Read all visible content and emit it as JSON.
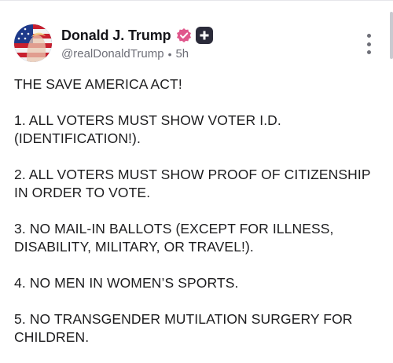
{
  "author": {
    "display_name": "Donald J. Trump",
    "handle": "@realDonaldTrump",
    "separator": "•",
    "time_ago": "5h",
    "verified_icon": "verified-check-icon",
    "badge_icon": "plus-badge-icon"
  },
  "post": {
    "paragraphs": [
      "THE SAVE AMERICA ACT!",
      "1. ALL VOTERS MUST SHOW VOTER I.D. (IDENTIFICATION!).",
      "2. ALL VOTERS MUST SHOW PROOF OF CITIZENSHIP IN ORDER TO VOTE.",
      "3. NO MAIL-IN BALLOTS (EXCEPT FOR ILLNESS, DISABILITY, MILITARY, OR TRAVEL!).",
      "4. NO MEN IN WOMEN’S SPORTS.",
      "5. NO TRANSGENDER MUTILATION SURGERY FOR CHILDREN."
    ]
  },
  "colors": {
    "verified": "#e0578c",
    "badge_bg": "#2b2b3a",
    "text": "#1c1c1e",
    "muted": "#6e6f78"
  },
  "menu": {
    "icon": "more-vertical-icon"
  }
}
